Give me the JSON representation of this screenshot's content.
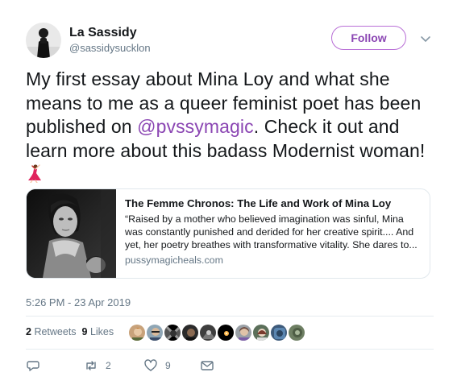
{
  "user": {
    "name": "La Sassidy",
    "handle": "@sassidysucklon"
  },
  "follow_label": "Follow",
  "tweet": {
    "text_before": "My first essay about Mina Loy and what she means to me as a queer feminist poet has been published on ",
    "mention": "@pvssymagic",
    "text_after": ". Check it out and learn more about this badass Modernist woman! ",
    "emoji": "dancer-emoji"
  },
  "card": {
    "title": "The Femme Chronos: The Life and Work of Mina Loy",
    "description": "“Raised by a mother who believed imagination was sinful, Mina was constantly punished and derided for her creative spirit.... And yet, her poetry breathes with transformative vitality. She dares to...",
    "domain": "pussymagicheals.com"
  },
  "timestamp": "5:26 PM - 23 Apr 2019",
  "stats": {
    "retweets": "2",
    "retweets_label": "Retweets",
    "likes": "9",
    "likes_label": "Likes"
  },
  "actions": {
    "reply_icon": "reply-icon",
    "retweet_count": "2",
    "like_count": "9",
    "dm_icon": "envelope-icon"
  },
  "colors": {
    "accent": "#8b46b3",
    "follow_border": "#b86ed6",
    "secondary": "#657786",
    "divider": "#e6ecf0"
  }
}
